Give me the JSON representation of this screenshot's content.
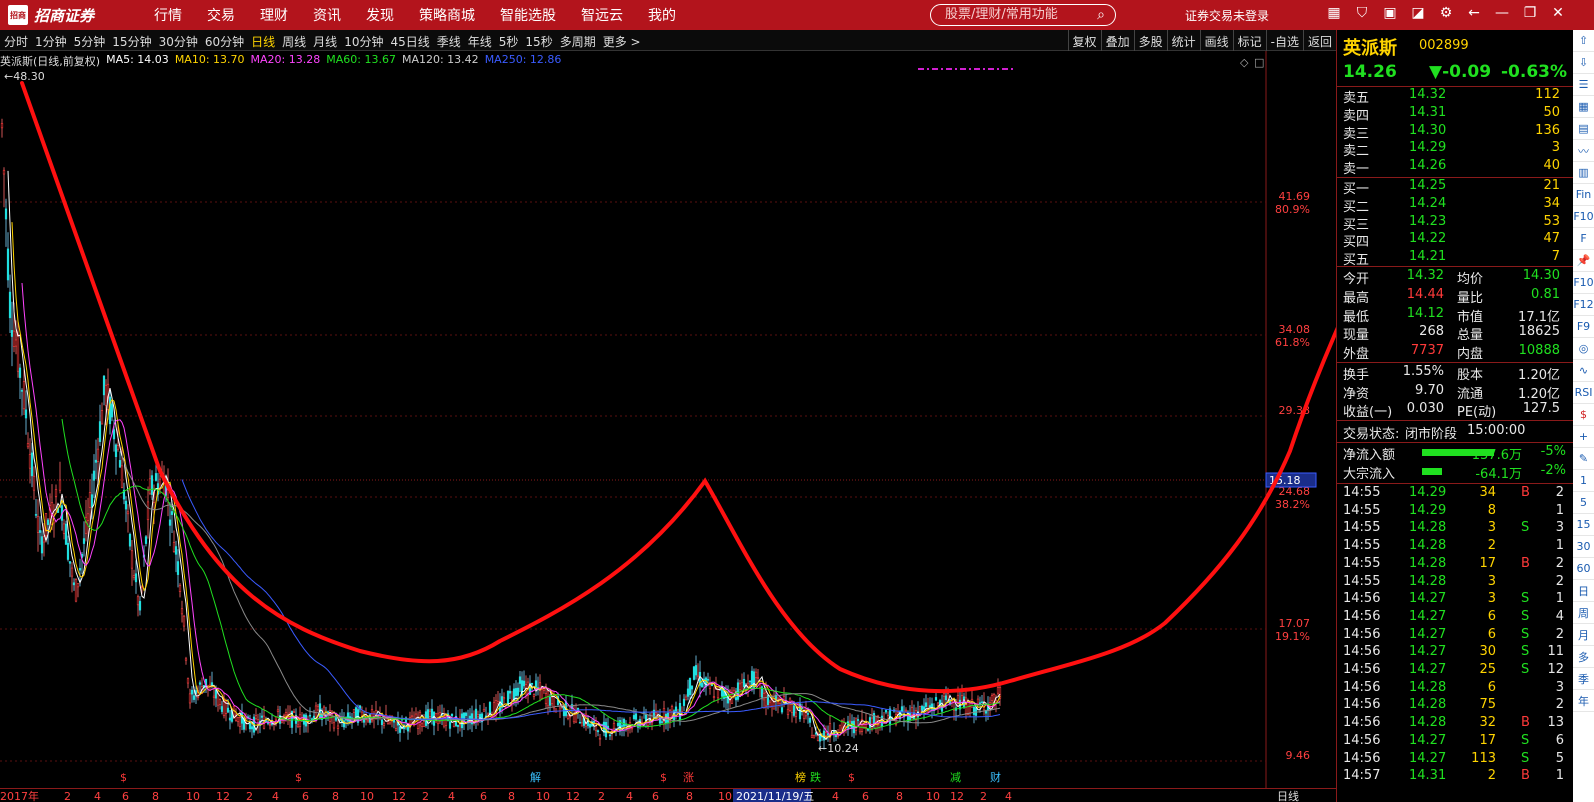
{
  "app": {
    "logo_mark": "招商证券",
    "brand": "招商证券",
    "nav": [
      "行情",
      "交易",
      "理财",
      "资讯",
      "发现",
      "策略商城",
      "智能选股",
      "智远云",
      "我的"
    ],
    "search_placeholder": "股票/理财/常用功能",
    "login_status": "证券交易未登录",
    "top_icons": [
      "calendar-icon",
      "shield-icon",
      "box-icon",
      "chart-icon",
      "gear-icon",
      "back-icon",
      "minimize-icon",
      "restore-icon",
      "close-icon"
    ]
  },
  "periods": {
    "items": [
      "分时",
      "1分钟",
      "5分钟",
      "15分钟",
      "30分钟",
      "60分钟",
      "日线",
      "周线",
      "月线",
      "10分钟",
      "45日线",
      "季线",
      "年线",
      "5秒",
      "15秒",
      "多周期",
      "更多 >"
    ],
    "active": "日线",
    "tools": [
      "复权",
      "叠加",
      "多股",
      "统计",
      "画线",
      "标记",
      "-自选",
      "返回"
    ]
  },
  "legend": {
    "title": "英派斯(日线,前复权)",
    "ma5": "MA5: 14.03",
    "ma10": "MA10: 13.70",
    "ma20": "MA20: 13.28",
    "ma60": "MA60: 13.67",
    "ma120": "MA120: 13.42",
    "ma250": "MA250: 12.86",
    "colors": {
      "ma5": "#ffffff",
      "ma10": "#ffd400",
      "ma20": "#ff44ff",
      "ma60": "#20e020",
      "ma120": "#cccccc",
      "ma250": "#3a5bff"
    }
  },
  "chart_data": {
    "type": "candlestick",
    "title": "英派斯(日线,前复权)",
    "y_ticks": [
      {
        "price": "41.69",
        "pct": "80.9%"
      },
      {
        "price": "34.08",
        "pct": "61.8%"
      },
      {
        "price": "29.38",
        "pct": ""
      },
      {
        "price": "24.68",
        "pct": "38.2%"
      },
      {
        "price": "17.07",
        "pct": "19.1%"
      },
      {
        "price": "9.46",
        "pct": ""
      }
    ],
    "current_price_label": "15.18",
    "high_label": "48.30",
    "low_label": "10.24",
    "x_labels": [
      "2017年",
      "2",
      "4",
      "6",
      "8",
      "10",
      "12",
      "2",
      "4",
      "6",
      "8",
      "10",
      "12",
      "2",
      "4",
      "6",
      "8",
      "10",
      "12",
      "2",
      "4",
      "6",
      "8",
      "10",
      "12",
      "2",
      "4",
      "6",
      "8",
      "10",
      "12",
      "2",
      "4"
    ],
    "x_highlight": "2021/11/19/五",
    "period_label": "日线",
    "markers": [
      {
        "text": "$",
        "color": "#ff3a3a"
      },
      {
        "text": "$",
        "color": "#ff3a3a"
      },
      {
        "text": "解",
        "color": "#3ac0ff"
      },
      {
        "text": "$",
        "color": "#ff3a3a"
      },
      {
        "text": "涨",
        "color": "#ff3a3a"
      },
      {
        "text": "榜",
        "color": "#ffd400"
      },
      {
        "text": "跌",
        "color": "#20e020"
      },
      {
        "text": "$",
        "color": "#ff3a3a"
      },
      {
        "text": "减",
        "color": "#20e020"
      },
      {
        "text": "财",
        "color": "#3ac0ff"
      }
    ],
    "grid": true
  },
  "quote": {
    "name": "英派斯",
    "code": "002899",
    "price": "14.26",
    "change": "▼-0.09",
    "change_pct": "-0.63%",
    "asks": [
      {
        "label": "卖五",
        "price": "14.32",
        "vol": "112"
      },
      {
        "label": "卖四",
        "price": "14.31",
        "vol": "50"
      },
      {
        "label": "卖三",
        "price": "14.30",
        "vol": "136"
      },
      {
        "label": "卖二",
        "price": "14.29",
        "vol": "3"
      },
      {
        "label": "卖一",
        "price": "14.26",
        "vol": "40"
      }
    ],
    "bids": [
      {
        "label": "买一",
        "price": "14.25",
        "vol": "21"
      },
      {
        "label": "买二",
        "price": "14.24",
        "vol": "34"
      },
      {
        "label": "买三",
        "price": "14.23",
        "vol": "53"
      },
      {
        "label": "买四",
        "price": "14.22",
        "vol": "47"
      },
      {
        "label": "买五",
        "price": "14.21",
        "vol": "7"
      }
    ],
    "stats": [
      {
        "l1": "今开",
        "v1": "14.32",
        "c1": "g",
        "l2": "均价",
        "v2": "14.30",
        "c2": "g"
      },
      {
        "l1": "最高",
        "v1": "14.44",
        "c1": "r",
        "l2": "量比",
        "v2": "0.81",
        "c2": "g"
      },
      {
        "l1": "最低",
        "v1": "14.12",
        "c1": "g",
        "l2": "市值",
        "v2": "17.1亿",
        "c2": "w"
      },
      {
        "l1": "现量",
        "v1": "268",
        "c1": "w",
        "l2": "总量",
        "v2": "18625",
        "c2": "w"
      },
      {
        "l1": "外盘",
        "v1": "7737",
        "c1": "r",
        "l2": "内盘",
        "v2": "10888",
        "c2": "g"
      }
    ],
    "stats2": [
      {
        "l1": "换手",
        "v1": "1.55%",
        "l2": "股本",
        "v2": "1.20亿"
      },
      {
        "l1": "净资",
        "v1": "9.70",
        "l2": "流通",
        "v2": "1.20亿"
      },
      {
        "l1": "收益(一)",
        "v1": "0.030",
        "l2": "PE(动)",
        "v2": "127.5"
      }
    ],
    "trade_status_label": "交易状态:",
    "trade_status": "闭市阶段",
    "trade_time": "15:00:00",
    "flows": [
      {
        "label": "净流入额",
        "value": "-137.6万",
        "pct": "-5%",
        "bar": 0.9
      },
      {
        "label": "大宗流入",
        "value": "-64.1万",
        "pct": "-2%",
        "bar": 0.25
      }
    ],
    "ticks": [
      {
        "t": "14:55",
        "p": "14.29",
        "v": "34",
        "s": "B",
        "n": "2"
      },
      {
        "t": "14:55",
        "p": "14.29",
        "v": "8",
        "s": "",
        "n": "1"
      },
      {
        "t": "14:55",
        "p": "14.28",
        "v": "3",
        "s": "S",
        "n": "3"
      },
      {
        "t": "14:55",
        "p": "14.28",
        "v": "2",
        "s": "",
        "n": "1"
      },
      {
        "t": "14:55",
        "p": "14.28",
        "v": "17",
        "s": "B",
        "n": "2"
      },
      {
        "t": "14:55",
        "p": "14.28",
        "v": "3",
        "s": "",
        "n": "2"
      },
      {
        "t": "14:56",
        "p": "14.27",
        "v": "3",
        "s": "S",
        "n": "1"
      },
      {
        "t": "14:56",
        "p": "14.27",
        "v": "6",
        "s": "S",
        "n": "4"
      },
      {
        "t": "14:56",
        "p": "14.27",
        "v": "6",
        "s": "S",
        "n": "2"
      },
      {
        "t": "14:56",
        "p": "14.27",
        "v": "30",
        "s": "S",
        "n": "11"
      },
      {
        "t": "14:56",
        "p": "14.27",
        "v": "25",
        "s": "S",
        "n": "12"
      },
      {
        "t": "14:56",
        "p": "14.28",
        "v": "6",
        "s": "",
        "n": "3"
      },
      {
        "t": "14:56",
        "p": "14.28",
        "v": "75",
        "s": "",
        "n": "2"
      },
      {
        "t": "14:56",
        "p": "14.28",
        "v": "32",
        "s": "B",
        "n": "13"
      },
      {
        "t": "14:56",
        "p": "14.27",
        "v": "17",
        "s": "S",
        "n": "6"
      },
      {
        "t": "14:56",
        "p": "14.27",
        "v": "113",
        "s": "S",
        "n": "5"
      },
      {
        "t": "14:57",
        "p": "14.31",
        "v": "2",
        "s": "B",
        "n": "1"
      }
    ]
  },
  "side_toolbar": [
    "up-icon",
    "down-icon",
    "list-icon",
    "grid-icon",
    "table-icon",
    "line-icon",
    "candle-icon",
    "fin-icon",
    "f10-icon",
    "f-icon",
    "pin-icon",
    "f10-icon",
    "f12-icon",
    "f9-icon",
    "o-icon",
    "wave-icon",
    "RSI",
    "$",
    "+",
    "pen-icon",
    "1",
    "5",
    "15",
    "30",
    "60",
    "日",
    "周",
    "月",
    "多",
    "季",
    "年"
  ]
}
